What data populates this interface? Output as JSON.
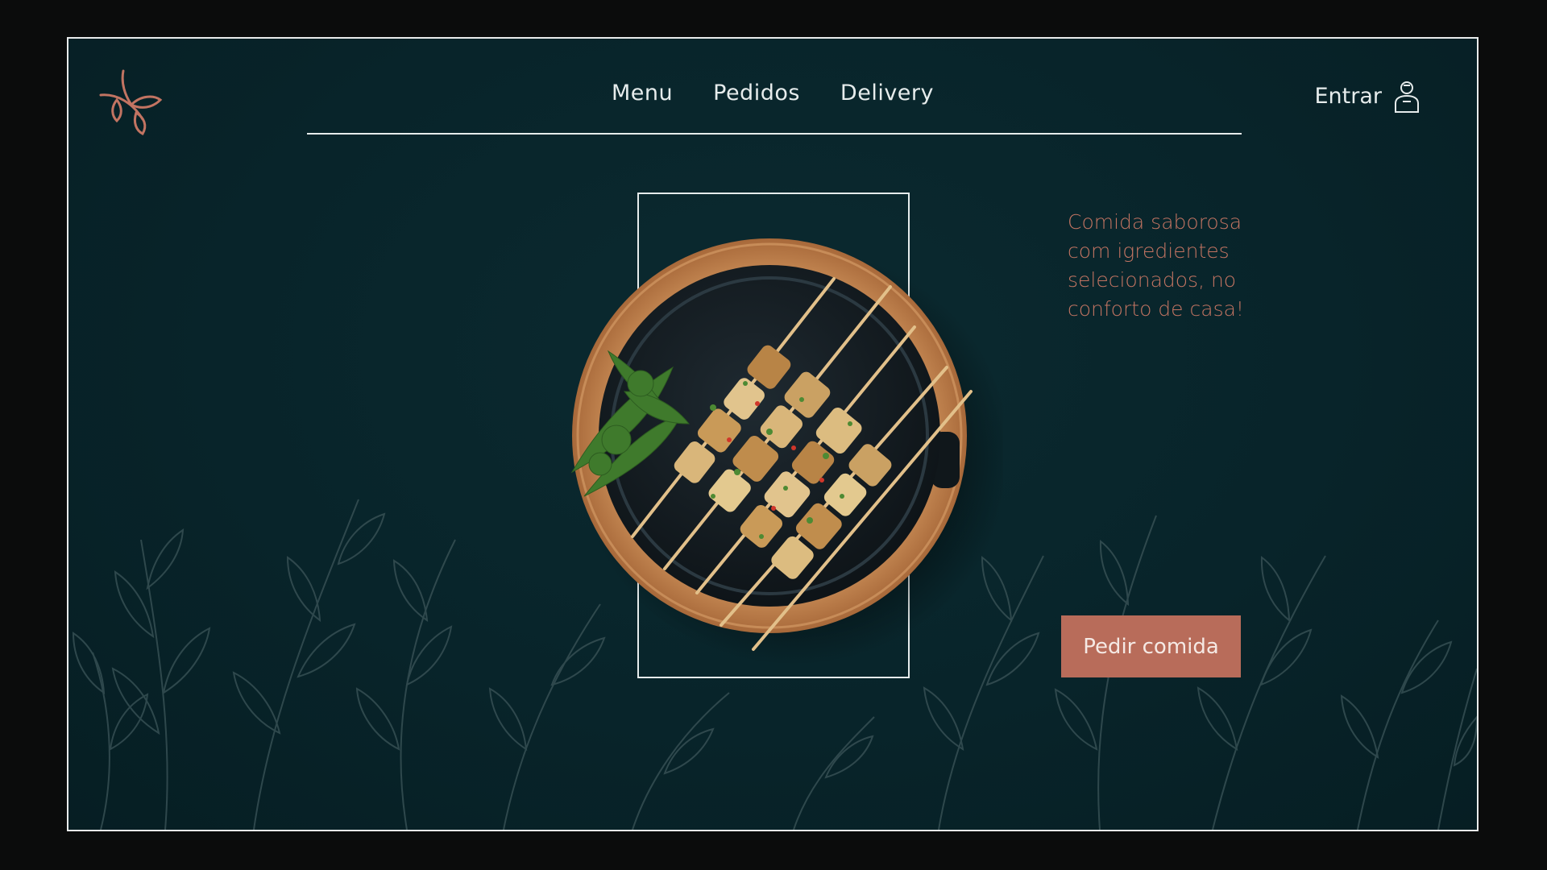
{
  "brand": {
    "logo_icon": "leaf-branch-icon",
    "accent_color": "#c27462"
  },
  "nav": {
    "items": [
      {
        "label": "Menu"
      },
      {
        "label": "Pedidos"
      },
      {
        "label": "Delivery"
      }
    ]
  },
  "account": {
    "login_label": "Entrar",
    "icon": "user-icon"
  },
  "hero": {
    "tagline": "Comida saborosa com igredientes selecionados, no conforto de casa!",
    "image": "skewers-dish-image",
    "cta_label": "Pedir comida",
    "cta_color": "#b86c5a"
  },
  "theme": {
    "background": "#08242a",
    "text": "#e6ecec"
  }
}
